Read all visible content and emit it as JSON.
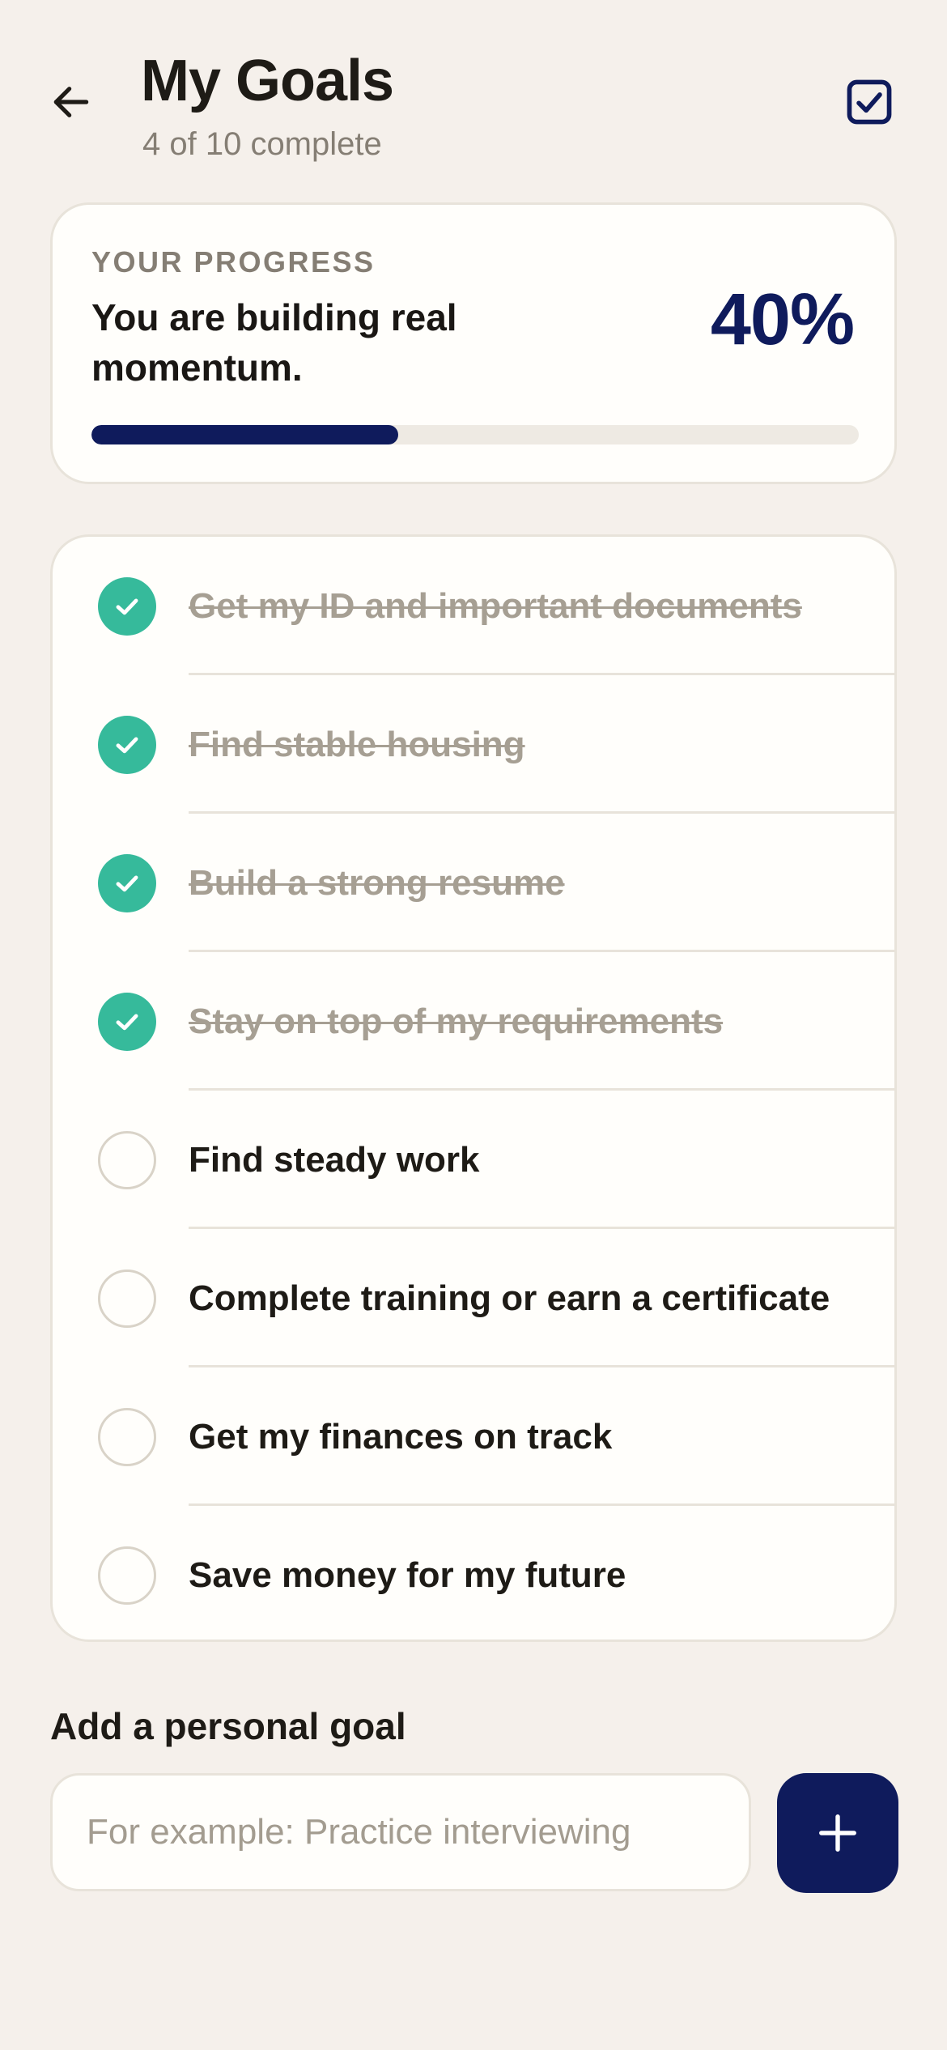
{
  "header": {
    "title": "My Goals",
    "subtitle": "4 of 10 complete",
    "back_icon": "arrow-left-icon",
    "action_icon": "checkbox-checked-icon"
  },
  "progress": {
    "eyebrow": "YOUR PROGRESS",
    "message": "You are building real momentum.",
    "percent_label": "40%",
    "fraction": 0.4
  },
  "goals": [
    {
      "label": "Get my ID and important documents",
      "done": true
    },
    {
      "label": "Find stable housing",
      "done": true
    },
    {
      "label": "Build a strong resume",
      "done": true
    },
    {
      "label": "Stay on top of my requirements",
      "done": true
    },
    {
      "label": "Find steady work",
      "done": false
    },
    {
      "label": "Complete training or earn a certificate",
      "done": false
    },
    {
      "label": "Get my finances on track",
      "done": false
    },
    {
      "label": "Save money for my future",
      "done": false
    }
  ],
  "add_goal": {
    "heading": "Add a personal goal",
    "placeholder": "For example: Practice interviewing",
    "value": "",
    "button_icon": "plus-icon"
  },
  "colors": {
    "background": "#F5F0EB",
    "card": "#FFFEFB",
    "accent_navy": "#0F1B5C",
    "done_green": "#36BA9B",
    "muted_text": "#857E74"
  }
}
